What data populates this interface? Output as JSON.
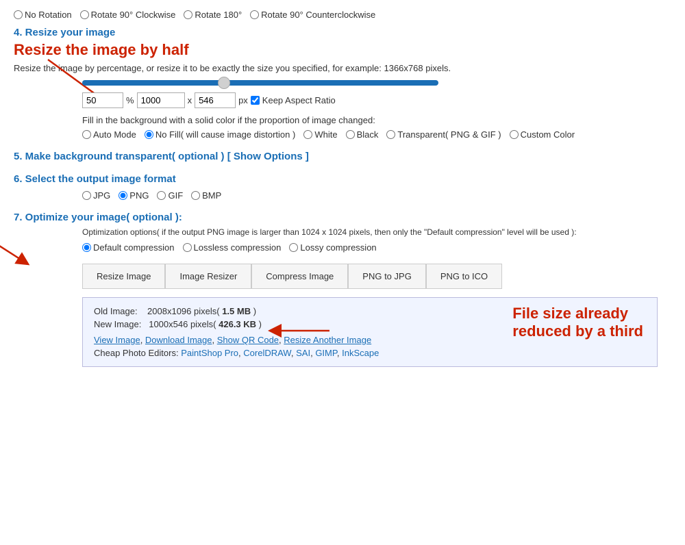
{
  "page": {
    "rotation_options": [
      "No Rotation",
      "Rotate 90° Clockwise",
      "Rotate 180°",
      "Rotate 90° Counterclockwise"
    ],
    "section4": {
      "number_label": "4. Resize your image",
      "main_title": "Resize the image by half",
      "desc": "Resize the image by percentage, or resize it to be exactly the size you specified, for example: 1366x768 pixels.",
      "slider_value": 38,
      "percentage_value": "50",
      "width_value": "1000",
      "height_value": "546",
      "unit_label": "px",
      "keep_aspect_ratio": "Keep Aspect Ratio",
      "fill_label": "Fill in the background with a solid color if the proportion of image changed:",
      "fill_options": [
        "Auto Mode",
        "No Fill( will cause image distortion )",
        "White",
        "Black",
        "Transparent( PNG & GIF )",
        "Custom Color"
      ],
      "fill_selected": "No Fill( will cause image distortion )"
    },
    "section5": {
      "title": "5. Make background transparent( optional ) [ Show Options ]"
    },
    "section6": {
      "title": "6. Select the output image format",
      "format_options": [
        "JPG",
        "PNG",
        "GIF",
        "BMP"
      ],
      "selected": "PNG"
    },
    "section7": {
      "title": "7. Optimize your image( optional ):",
      "note": "Optimization options( if the output PNG image is larger than 1024 x 1024 pixels, then only the \"Default compression\" level will be used ):",
      "compression_options": [
        "Default compression",
        "Lossless compression",
        "Lossy compression"
      ],
      "selected": "Default compression"
    },
    "buttons": [
      "Resize Image",
      "Image Resizer",
      "Compress Image",
      "PNG to JPG",
      "PNG to ICO"
    ],
    "result": {
      "old_image_label": "Old Image:",
      "old_image_value": "2008x1096 pixels(",
      "old_image_size": "1.5 MB",
      "old_image_end": ")",
      "new_image_label": "New Image:",
      "new_image_value": "1000x546 pixels(",
      "new_image_size": "426.3 KB",
      "new_image_end": ")",
      "annotation": "File size already\nreduced by a third",
      "links": [
        "View Image",
        "Download Image",
        "Show QR Code",
        "Resize Another Image"
      ],
      "cheap_label": "Cheap Photo Editors:",
      "editors": [
        "PaintShop Pro",
        "CorelDRAW",
        "SAI",
        "GIMP",
        "InkScape"
      ]
    },
    "annotations": {
      "arrow1_label": "",
      "arrow2_label": ""
    }
  }
}
